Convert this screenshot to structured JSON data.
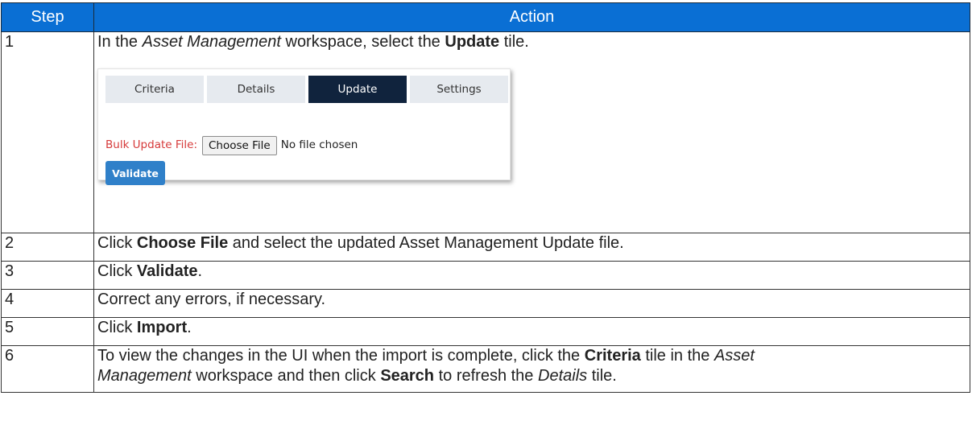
{
  "table": {
    "headers": {
      "step": "Step",
      "action": "Action"
    },
    "rows": [
      {
        "step": "1",
        "parts": [
          "In the ",
          "Asset Management",
          " workspace, select the ",
          "Update",
          " tile."
        ]
      },
      {
        "step": "2",
        "parts": [
          "Click ",
          "Choose File",
          " and select the updated Asset Management Update file."
        ]
      },
      {
        "step": "3",
        "parts": [
          "Click ",
          "Validate",
          "."
        ]
      },
      {
        "step": "4",
        "text": "Correct any errors, if necessary."
      },
      {
        "step": "5",
        "parts": [
          "Click ",
          "Import",
          "."
        ]
      },
      {
        "step": "6",
        "parts": [
          "To view the changes in the UI when the import is complete, click the ",
          "Criteria",
          " tile in the ",
          "Asset",
          "Management",
          " workspace and then click ",
          "Search",
          " to refresh the ",
          "Details",
          " tile."
        ]
      }
    ]
  },
  "screenshot": {
    "tabs": [
      "Criteria",
      "Details",
      "Update",
      "Settings"
    ],
    "active_tab": "Update",
    "bulk_label": "Bulk Update File:",
    "choose_file_label": "Choose File",
    "no_file_text": "No file chosen",
    "validate_label": "Validate"
  },
  "colors": {
    "header_bg": "#0a6fd4",
    "active_tab_bg": "#10233d",
    "tab_bg": "#e6eaef",
    "validate_bg": "#2f80c9",
    "required_label": "#d63a3a"
  }
}
